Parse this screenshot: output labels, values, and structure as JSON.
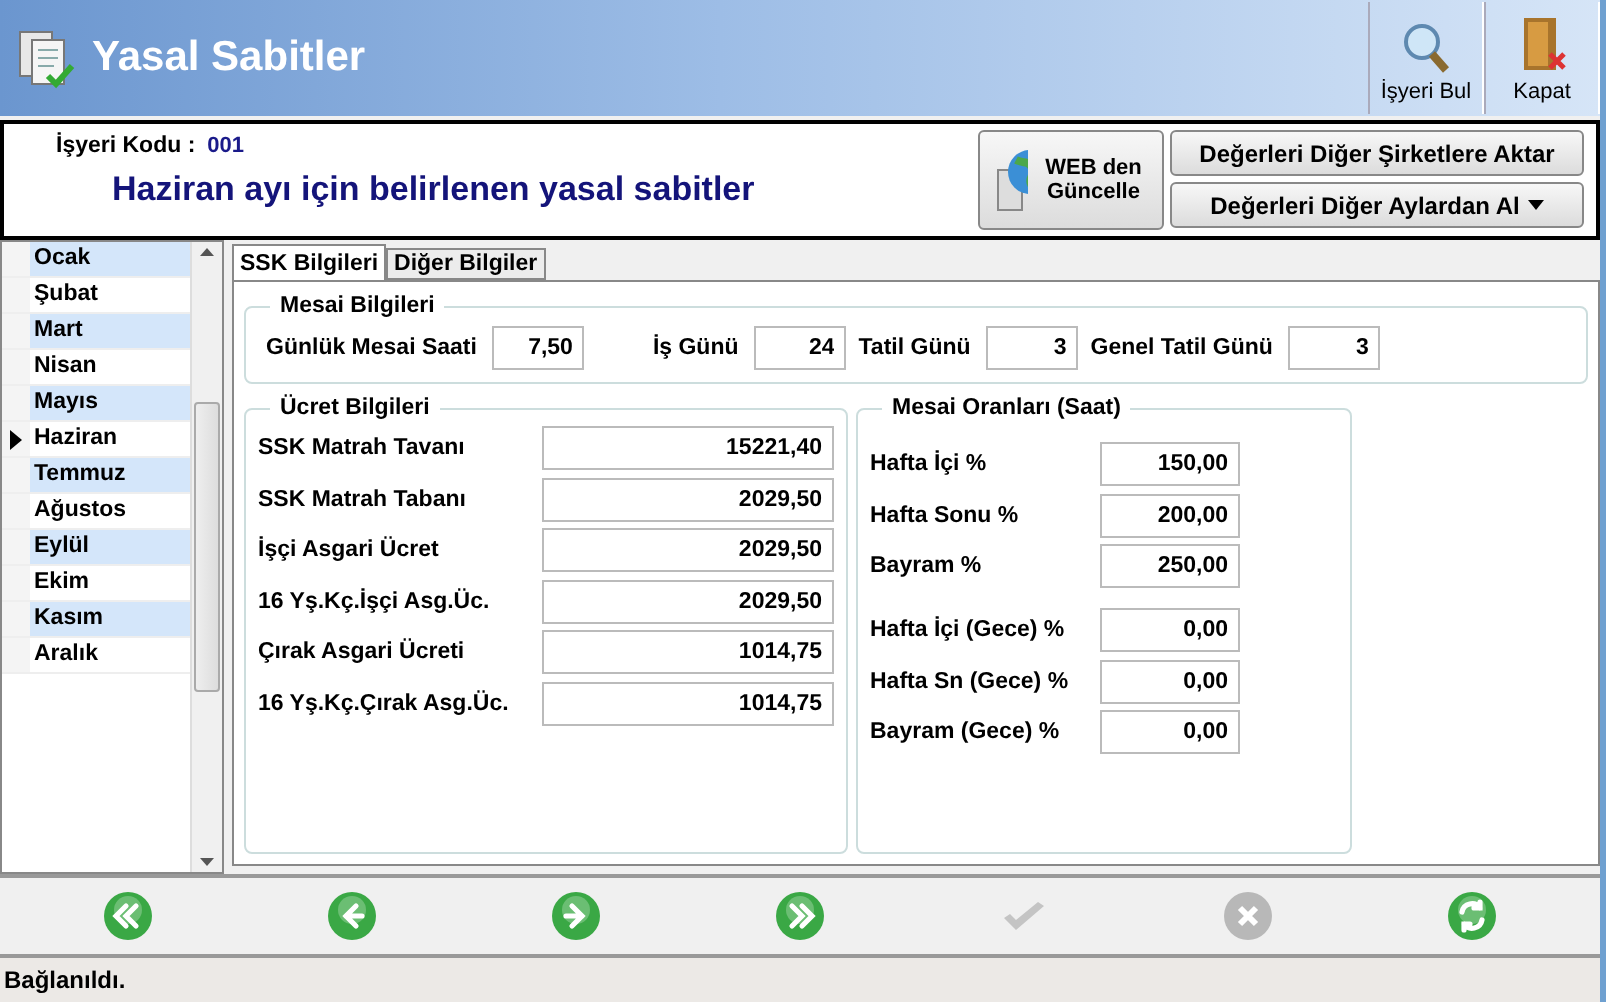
{
  "window": {
    "title": "Yasal Sabitler"
  },
  "toolbar": [
    {
      "kind": "find",
      "label": "İşyeri Bul"
    },
    {
      "kind": "close",
      "label": "Kapat"
    }
  ],
  "info": {
    "code_label": "İşyeri Kodu :",
    "code_value": "001",
    "heading": "Haziran ayı için belirlenen yasal sabitler"
  },
  "actions": {
    "web_update": "WEB den Güncelle",
    "transfer": "Değerleri Diğer Şirketlere Aktar",
    "copy_from": "Değerleri Diğer Aylardan Al"
  },
  "months": [
    {
      "label": "Ocak",
      "selected": false
    },
    {
      "label": "Şubat",
      "selected": false
    },
    {
      "label": "Mart",
      "selected": false
    },
    {
      "label": "Nisan",
      "selected": false
    },
    {
      "label": "Mayıs",
      "selected": false
    },
    {
      "label": "Haziran",
      "selected": true
    },
    {
      "label": "Temmuz",
      "selected": false
    },
    {
      "label": "Ağustos",
      "selected": false
    },
    {
      "label": "Eylül",
      "selected": false
    },
    {
      "label": "Ekim",
      "selected": false
    },
    {
      "label": "Kasım",
      "selected": false
    },
    {
      "label": "Aralık",
      "selected": false
    }
  ],
  "tabs": [
    {
      "label": "SSK Bilgileri",
      "selected": true
    },
    {
      "label": "Diğer Bilgiler",
      "selected": false
    }
  ],
  "mesai": {
    "title": "Mesai Bilgileri",
    "fields": [
      {
        "label": "Günlük Mesai Saati",
        "value": "7,50"
      },
      {
        "label": "İş Günü",
        "value": "24"
      },
      {
        "label": "Tatil Günü",
        "value": "3"
      },
      {
        "label": "Genel Tatil Günü",
        "value": "3"
      }
    ]
  },
  "ucret": {
    "title": "Ücret Bilgileri",
    "fields": [
      {
        "label": "SSK Matrah Tavanı",
        "value": "15221,40"
      },
      {
        "label": "SSK Matrah Tabanı",
        "value": "2029,50"
      },
      {
        "label": "İşçi Asgari Ücret",
        "value": "2029,50"
      },
      {
        "label": "16 Yş.Kç.İşçi Asg.Üc.",
        "value": "2029,50"
      },
      {
        "label": "Çırak Asgari Ücreti",
        "value": "1014,75"
      },
      {
        "label": "16 Yş.Kç.Çırak Asg.Üc.",
        "value": "1014,75"
      }
    ]
  },
  "oranlar": {
    "title": "Mesai Oranları (Saat)",
    "groups": [
      [
        {
          "label": "Hafta İçi %",
          "value": "150,00"
        },
        {
          "label": "Hafta Sonu %",
          "value": "200,00"
        },
        {
          "label": "Bayram %",
          "value": "250,00"
        }
      ],
      [
        {
          "label": "Hafta İçi (Gece) %",
          "value": "0,00"
        },
        {
          "label": "Hafta Sn (Gece) %",
          "value": "0,00"
        },
        {
          "label": "Bayram (Gece) %",
          "value": "0,00"
        }
      ]
    ]
  },
  "nav": [
    {
      "kind": "first",
      "disabled": false
    },
    {
      "kind": "prev",
      "disabled": false
    },
    {
      "kind": "next",
      "disabled": false
    },
    {
      "kind": "last",
      "disabled": false
    },
    {
      "kind": "save",
      "disabled": true
    },
    {
      "kind": "cancel",
      "disabled": true
    },
    {
      "kind": "refresh",
      "disabled": false
    }
  ],
  "status_bar": "Bağlanıldı."
}
